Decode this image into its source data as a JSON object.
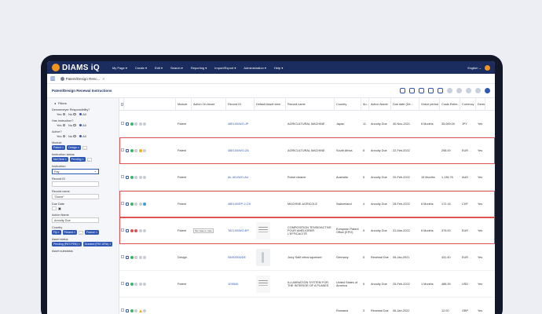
{
  "app": {
    "logo_text": "DIAMS iQ",
    "menu": [
      "My Page ▾",
      "Create ▾",
      "Edit ▾",
      "Search ▾",
      "Reporting ▾",
      "Import/Export ▾",
      "Administration ▾",
      "Help ▾"
    ],
    "language": "English ⌄"
  },
  "tabs": [
    {
      "label": "Patent/Design Renc..."
    }
  ],
  "page_title": "Patent/Design Renewal Instructions",
  "filters": {
    "header": "Filters",
    "dm_label": "Dennemeyer Responsibility?",
    "has_instr_label": "Has Instruction?",
    "active_label": "Active?",
    "radio_yes": "Yes",
    "radio_no": "No",
    "radio_all": "All",
    "module_label": "Module",
    "module_chips": [
      "Patent",
      "Design"
    ],
    "instr_status_label": "Instruction status",
    "instr_status_chips": [
      "Not Sent",
      "Pending"
    ],
    "instruction_label": "Instruction",
    "instruction_value": "Pay",
    "record_id_label": "Record ID",
    "record_name_label": "Record name",
    "record_name_value": "\"Dome\"",
    "due_date_label": "Due Date",
    "action_name_label": "Action Name",
    "action_name_value": "Annuity Due",
    "country_label": "Country",
    "country_chips": [
      "Fiji",
      "Finland",
      "France"
    ],
    "asset_status_label": "Asset status",
    "asset_status_chips": [
      "Pending (PAT-PEN)",
      "Granted (PAT-GRA)"
    ],
    "asset_substatus_label": "Asset substatus"
  },
  "table": {
    "headers": [
      "Module",
      "Action On Asset",
      "Record ID",
      "Default Asset view",
      "Record name",
      "Country",
      "An...",
      "Action Name",
      "Due date (De...",
      "Grace period",
      "Costs Estim...",
      "Currency",
      "Dema"
    ],
    "rows": [
      {
        "module": "Patent",
        "action": "",
        "record_id": "45E100/WO-JP",
        "record_name": "AGRICULTURAL MACHINE",
        "country": "Japan",
        "an": "11",
        "action_name": "Annuity Due",
        "due": "30-Nov-2021",
        "grace": "6 Months",
        "cost": "35,069.00",
        "currency": "JPY",
        "dema": "Yes"
      },
      {
        "module": "Patent",
        "action": "",
        "record_id": "45E100/WO-ZA",
        "record_name": "AGRICULTURAL MACHINE",
        "country": "South Africa",
        "an": "8",
        "action_name": "Annuity Due",
        "due": "22-Feb-2022",
        "grace": "",
        "cost": "298.00",
        "currency": "EUR",
        "dema": "Yes"
      },
      {
        "module": "Patent",
        "action": "",
        "record_id": "AL-401/WO-AU",
        "record_name": "Robot cleaner",
        "country": "Australia",
        "an": "5",
        "action_name": "Annuity Due",
        "due": "20-Feb-2022",
        "grace": "15 Months",
        "cost": "1,136.76",
        "currency": "AUD",
        "dema": "Yes"
      },
      {
        "module": "Patent",
        "action": "",
        "record_id": "45E100/EP-2-CH",
        "record_name": "MACHINE AGRICOLE",
        "country": "Switzerland",
        "an": "4",
        "action_name": "Annuity Due",
        "due": "28-Feb-2022",
        "grace": "6 Months",
        "cost": "172.16",
        "currency": "CHF",
        "dema": "Yes"
      },
      {
        "module": "Patent",
        "action": "Set case to man...",
        "record_id": "TAT100/WO-EP",
        "record_name": "COMPOSITION TENSIOACTIVE POUR AMÉLIORER L'EFFICACITÉ",
        "country": "European Patent Office (EPO)",
        "an": "5",
        "action_name": "Annuity Due",
        "due": "31-Mar-2022",
        "grace": "6 Months",
        "cost": "375.00",
        "currency": "EUR",
        "dema": "Yes"
      },
      {
        "module": "Design",
        "action": "",
        "record_id": "SMX0000/DE",
        "record_name": "Juicy Salif citrus squeezer",
        "country": "Germany",
        "an": "5",
        "action_name": "Renewal Due",
        "due": "05-Jan-2021",
        "grace": "",
        "cost": "431.40",
        "currency": "EUR",
        "dema": "Yes"
      },
      {
        "module": "Patent",
        "action": "",
        "record_id": "1D0540",
        "record_name": "ILLUMINATION SYSTEM FOR THE INTERIOR OF A PLANES",
        "country": "United States of America",
        "an": "5",
        "action_name": "Annuity Due",
        "due": "25-Feb-2022",
        "grace": "1 Months",
        "cost": "488.39",
        "currency": "USD",
        "dema": "Yes"
      },
      {
        "module": "",
        "action": "",
        "record_id": "",
        "record_name": "",
        "country": "Romania",
        "an": "3",
        "action_name": "Renewal Due",
        "due": "06-Jan-2022",
        "grace": "",
        "cost": "12.00",
        "currency": "GBP",
        "dema": "Yes"
      }
    ]
  }
}
